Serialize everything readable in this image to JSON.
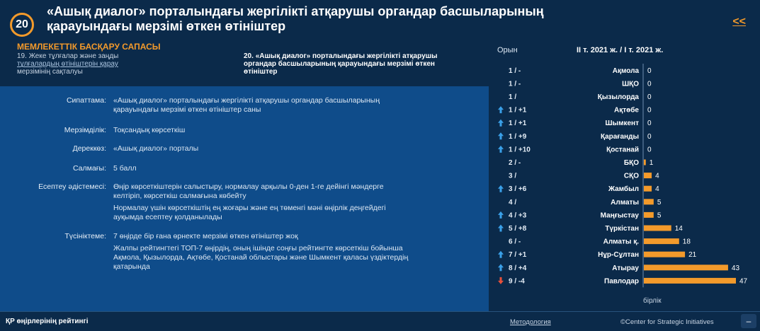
{
  "header": {
    "number": "20",
    "title": "«Ашық диалог» порталындағы жергілікті атқарушы органдар басшыларының қарауындағы мерзімі өткен өтініштер",
    "back_label": "<<"
  },
  "section_label": "МЕМЛЕКЕТТІК БАСҚАРУ САПАСЫ",
  "nav": {
    "prev_num": "19.",
    "prev_text_a": "Жеке тұлғалар және заңды",
    "prev_text_link": "тұлғалардың өтініштерін қарау",
    "prev_text_c": "мерзімінің сақталуы",
    "current_num": "20.",
    "current_text": "«Ашық диалог» порталындағы жергілікті атқарушы органдар басшыларының қарауындағы мерзімі өткен өтініштер"
  },
  "details": {
    "description_label": "Сипаттама:",
    "description": "«Ашық диалог» порталындағы жергілікті атқарушы органдар басшыларының қарауындағы мерзімі өткен өтініштер саны",
    "periodicity_label": "Мерзімділік:",
    "periodicity": "Тоқсандық көрсеткіш",
    "source_label": "Дереккөз:",
    "source": "«Ашық диалог» порталы",
    "weight_label": "Салмағы:",
    "weight": "5 балл",
    "method_label": "Есептеу әдістемесі:",
    "method_1": "Өңір көрсеткіштерін салыстыру, нормалау арқылы 0-ден 1-ге дейінгі мәндерге келтіріп, көрсеткіш салмағына көбейту",
    "method_2": "Нормалау үшін көрсеткіштің ең жоғары және ең төменгі мәні өңірлік деңгейдегі ауқымда есептеу қолданылады",
    "note_label": "Түсініктеме:",
    "note_1": "7 өңірде бір ғана өрнекте мерзімі өткен өтініштер жоқ",
    "note_2": "Жалпы рейтингтегі ТОП-7 өңірдің, оның ішінде соңғы рейтингте көрсеткіш бойынша Ақмола, Қызылорда, Ақтөбе, Қостанай облыстары және Шымкент қаласы үздіктердің қатарында"
  },
  "chart_headers": {
    "rank_label": "Орын",
    "value_label": "II т. 2021 ж. / I т. 2021 ж."
  },
  "chart_data": {
    "type": "bar",
    "orientation": "horizontal",
    "unit": "бірлік",
    "categories": [
      "Ақмола",
      "ШҚО",
      "Қызылорда",
      "Ақтөбе",
      "Шымкент",
      "Қарағанды",
      "Қостанай",
      "БҚО",
      "СҚО",
      "Жамбыл",
      "Алматы",
      "Маңғыстау",
      "Түркістан",
      "Алматы қ.",
      "Нұр-Сұлтан",
      "Атырау",
      "Павлодар"
    ],
    "values": [
      0,
      0,
      0,
      0,
      0,
      0,
      0,
      1,
      4,
      4,
      5,
      5,
      14,
      18,
      21,
      43,
      47
    ],
    "rank": [
      "1",
      "1",
      "1",
      "1",
      "1",
      "1",
      "1",
      "2",
      "3",
      "3",
      "4",
      "4",
      "5",
      "6",
      "7",
      "8",
      "9"
    ],
    "rank_change": [
      "-",
      "-",
      "",
      "+1",
      "+1",
      "+9",
      "+10",
      "-",
      "",
      "+6",
      "",
      "+3",
      "+8",
      "-",
      "+1",
      "+4",
      "-4"
    ],
    "trend": [
      "none",
      "none",
      "none",
      "up",
      "up",
      "up",
      "up",
      "none",
      "none",
      "up",
      "none",
      "up",
      "up",
      "none",
      "up",
      "up",
      "down"
    ],
    "xlim": [
      0,
      47
    ],
    "colors": {
      "bar": "#f39a2b",
      "up": "#3aa0e8",
      "down": "#e8503a"
    }
  },
  "footer": {
    "left": "ҚР өңірлерінің рейтингі",
    "methodology": "Методология",
    "credit": "©Center for Strategic Initiatives",
    "toggle": "–"
  }
}
